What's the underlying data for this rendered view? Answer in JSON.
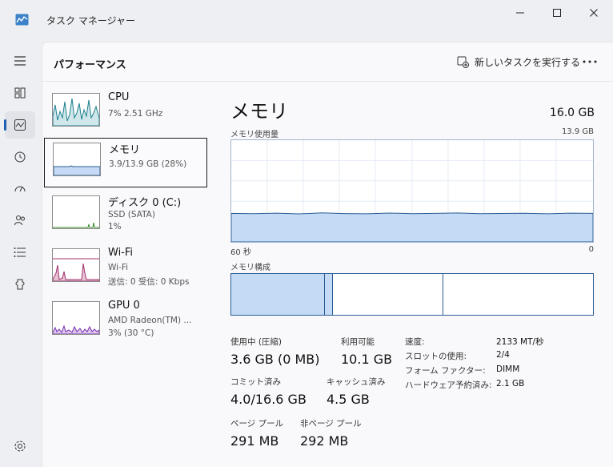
{
  "window": {
    "title": "タスク マネージャー",
    "icons": {
      "app": "task-manager-icon",
      "minimize": "minimize-icon",
      "maximize": "maximize-icon",
      "close": "close-icon"
    }
  },
  "nav": {
    "items": [
      {
        "icon": "hamburger-menu-icon"
      },
      {
        "icon": "processes-icon"
      },
      {
        "icon": "performance-icon",
        "active": true
      },
      {
        "icon": "app-history-icon"
      },
      {
        "icon": "startup-apps-icon"
      },
      {
        "icon": "users-icon"
      },
      {
        "icon": "details-icon"
      },
      {
        "icon": "services-icon"
      },
      {
        "icon": "settings-icon"
      }
    ]
  },
  "header": {
    "title": "パフォーマンス",
    "run_task_label": "新しいタスクを実行する",
    "more_label": "···"
  },
  "devices": [
    {
      "name": "CPU",
      "line1": "7%  2.51 GHz",
      "line2": "",
      "selected": false
    },
    {
      "name": "メモリ",
      "line1": "3.9/13.9 GB (28%)",
      "line2": "",
      "selected": true
    },
    {
      "name": "ディスク 0 (C:)",
      "line1": "SSD (SATA)",
      "line2": "1%",
      "selected": false
    },
    {
      "name": "Wi-Fi",
      "line1": "Wi-Fi",
      "line2": "送信: 0 受信: 0 Kbps",
      "selected": false
    },
    {
      "name": "GPU 0",
      "line1": "AMD Radeon(TM) ...",
      "line2": "3%  (30 °C)",
      "selected": false
    }
  ],
  "memory": {
    "title": "メモリ",
    "total": "16.0 GB",
    "usage_label": "メモリ使用量",
    "usage_max": "13.9 GB",
    "axis_left": "60 秒",
    "axis_right": "0",
    "usage_fraction": 0.28,
    "composition_label": "メモリ構成",
    "stats": {
      "in_use_label": "使用中 (圧縮)",
      "in_use_value": "3.6 GB (0 MB)",
      "available_label": "利用可能",
      "available_value": "10.1 GB",
      "committed_label": "コミット済み",
      "committed_value": "4.0/16.6 GB",
      "cached_label": "キャッシュ済み",
      "cached_value": "4.5 GB",
      "paged_label": "ページ プール",
      "paged_value": "291 MB",
      "nonpaged_label": "非ページ プール",
      "nonpaged_value": "292 MB"
    },
    "specs": {
      "speed_label": "速度:",
      "speed_value": "2133 MT/秒",
      "slots_label": "スロットの使用:",
      "slots_value": "2/4",
      "form_label": "フォーム ファクター:",
      "form_value": "DIMM",
      "reserved_label": "ハードウェア予約済み:",
      "reserved_value": "2.1 GB"
    }
  },
  "colors": {
    "accent": "#1f5fb0",
    "memory_fill": "#c5daf4",
    "memory_line": "#2b5d96",
    "cpu_line": "#1a7f8e",
    "wifi_line": "#a0306a",
    "gpu_line": "#7a2fb0",
    "disk_line": "#3a8a2a"
  }
}
